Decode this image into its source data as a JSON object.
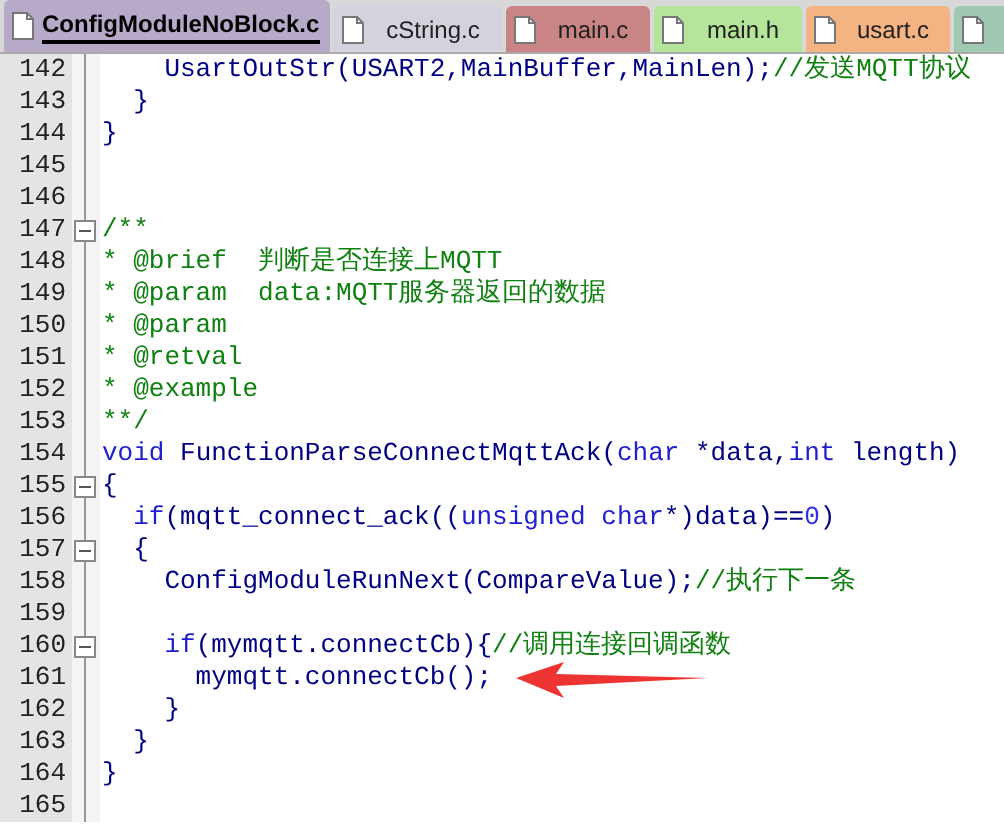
{
  "tabs": [
    {
      "label": "ConfigModuleNoBlock.c",
      "selected": true,
      "color": "#b7aac8"
    },
    {
      "label": "cString.c",
      "selected": false,
      "color": "#d3d3dd"
    },
    {
      "label": "main.c",
      "selected": false,
      "color": "#c98585"
    },
    {
      "label": "main.h",
      "selected": false,
      "color": "#b5e59b"
    },
    {
      "label": "usart.c",
      "selected": false,
      "color": "#f4b382"
    },
    {
      "selected": false,
      "color": "#9fc9b2"
    }
  ],
  "lines": [
    {
      "number": "142",
      "collapsible": false,
      "tokens": [
        {
          "kind": "plain",
          "text": "    UsartOutStr(USART2,MainBuffer,MainLen);"
        },
        {
          "kind": "comment",
          "text": "//发送MQTT协议"
        }
      ]
    },
    {
      "number": "143",
      "collapsible": false,
      "tokens": [
        {
          "kind": "plain",
          "text": "  }"
        }
      ]
    },
    {
      "number": "144",
      "collapsible": false,
      "tokens": [
        {
          "kind": "plain",
          "text": "}"
        }
      ]
    },
    {
      "number": "145",
      "collapsible": false
    },
    {
      "number": "146",
      "collapsible": false
    },
    {
      "number": "147",
      "collapsible": true,
      "tokens": [
        {
          "kind": "comment",
          "text": "/**"
        }
      ]
    },
    {
      "number": "148",
      "collapsible": false,
      "tokens": [
        {
          "kind": "comment",
          "text": "* @brief  判断是否连接上MQTT"
        }
      ]
    },
    {
      "number": "149",
      "collapsible": false,
      "tokens": [
        {
          "kind": "comment",
          "text": "* @param  data:MQTT服务器返回的数据"
        }
      ]
    },
    {
      "number": "150",
      "collapsible": false,
      "tokens": [
        {
          "kind": "comment",
          "text": "* @param"
        }
      ]
    },
    {
      "number": "151",
      "collapsible": false,
      "tokens": [
        {
          "kind": "comment",
          "text": "* @retval"
        }
      ]
    },
    {
      "number": "152",
      "collapsible": false,
      "tokens": [
        {
          "kind": "comment",
          "text": "* @example"
        }
      ]
    },
    {
      "number": "153",
      "collapsible": false,
      "tokens": [
        {
          "kind": "comment",
          "text": "**/"
        }
      ]
    },
    {
      "number": "154",
      "collapsible": false,
      "tokens": [
        {
          "kind": "keyword",
          "text": "void"
        },
        {
          "kind": "plain",
          "text": " FunctionParseConnectMqttAck("
        },
        {
          "kind": "keyword",
          "text": "char"
        },
        {
          "kind": "plain",
          "text": " *data,"
        },
        {
          "kind": "keyword",
          "text": "int"
        },
        {
          "kind": "plain",
          "text": " length)"
        }
      ]
    },
    {
      "number": "155",
      "collapsible": true,
      "tokens": [
        {
          "kind": "plain",
          "text": "{"
        }
      ]
    },
    {
      "number": "156",
      "collapsible": false,
      "tokens": [
        {
          "kind": "keyword",
          "text": "  if"
        },
        {
          "kind": "plain",
          "text": "(mqtt_connect_ack(("
        },
        {
          "kind": "keyword",
          "text": "unsigned char"
        },
        {
          "kind": "plain",
          "text": "*)data)=="
        },
        {
          "kind": "number",
          "text": "0"
        },
        {
          "kind": "plain",
          "text": ")"
        }
      ]
    },
    {
      "number": "157",
      "collapsible": true,
      "tokens": [
        {
          "kind": "plain",
          "text": "  {"
        }
      ]
    },
    {
      "number": "158",
      "collapsible": false,
      "tokens": [
        {
          "kind": "plain",
          "text": "    ConfigModuleRunNext(CompareValue);"
        },
        {
          "kind": "comment",
          "text": "//执行下一条"
        }
      ]
    },
    {
      "number": "159",
      "collapsible": false
    },
    {
      "number": "160",
      "collapsible": true,
      "tokens": [
        {
          "kind": "keyword",
          "text": "    if"
        },
        {
          "kind": "plain",
          "text": "(mymqtt.connectCb){"
        },
        {
          "kind": "comment",
          "text": "//调用连接回调函数"
        }
      ]
    },
    {
      "number": "161",
      "collapsible": false,
      "tokens": [
        {
          "kind": "plain",
          "text": "      mymqtt.connectCb();"
        }
      ]
    },
    {
      "number": "162",
      "collapsible": false,
      "tokens": [
        {
          "kind": "plain",
          "text": "    }"
        }
      ]
    },
    {
      "number": "163",
      "collapsible": false,
      "tokens": [
        {
          "kind": "plain",
          "text": "  }"
        }
      ]
    },
    {
      "number": "164",
      "collapsible": false,
      "tokens": [
        {
          "kind": "plain",
          "text": "}"
        }
      ]
    },
    {
      "number": "165",
      "collapsible": false
    }
  ]
}
